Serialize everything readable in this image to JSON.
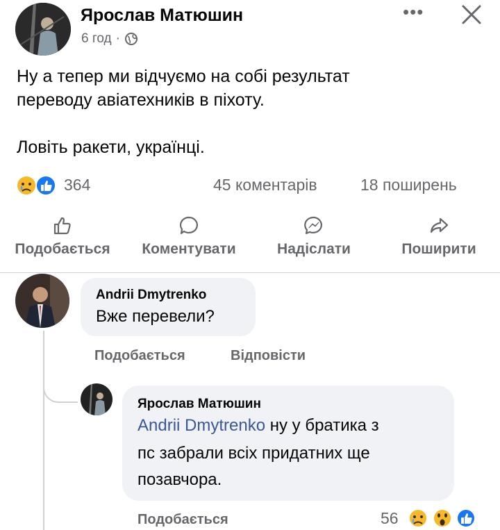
{
  "post": {
    "author": "Ярослав Матюшин",
    "time": "6 год",
    "separator": "·",
    "text_lines": [
      "Ну а тепер ми відчуємо на собі результат",
      "переводу авіатехників в піхоту.",
      "Ловіть ракети, українці."
    ],
    "reactions_count": "364",
    "comments_count": "45 коментарів",
    "shares_count": "18 поширень",
    "reaction_icons": [
      "sad-reaction-icon",
      "like-reaction-icon"
    ],
    "more_label": "•••",
    "actions": {
      "like": "Подобається",
      "comment": "Коментувати",
      "send": "Надіслати",
      "share": "Поширити"
    }
  },
  "comments": [
    {
      "author": "Andrii Dmytrenko",
      "text": "Вже перевели?",
      "like_label": "Подобається",
      "reply_label": "Відповісти"
    },
    {
      "author": "Ярослав Матюшин",
      "mention": "Andrii Dmytrenko",
      "text_lines": [
        "ну у братика з",
        "пс забрали всіх придатних ще",
        "позавчора."
      ],
      "like_label": "Подобається",
      "reactions_count": "56",
      "reaction_icons": [
        "sad-reaction-icon",
        "wow-reaction-icon",
        "like-reaction-icon"
      ]
    }
  ],
  "colors": {
    "text": "#050505",
    "secondary": "#65676b",
    "bubble": "#f0f2f5",
    "mention": "#385898",
    "like_blue": "#1877f2",
    "emoji_yellow": "#f7b928"
  }
}
